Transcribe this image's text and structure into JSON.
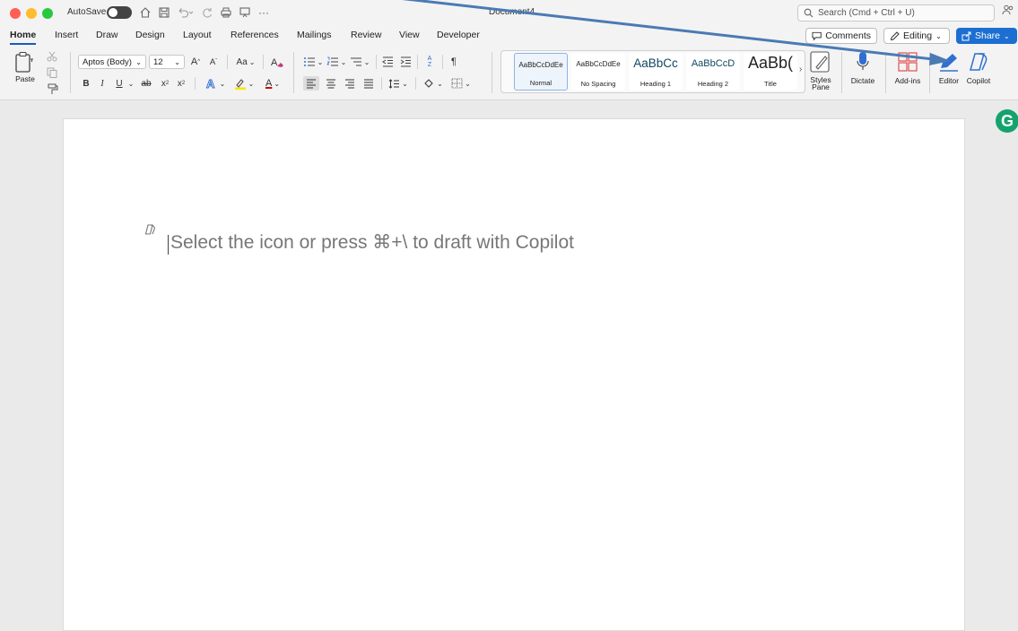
{
  "titlebar": {
    "autosave_label": "AutoSave",
    "document_title": "Document4",
    "search_placeholder": "Search (Cmd + Ctrl + U)"
  },
  "tabs": [
    "Home",
    "Insert",
    "Draw",
    "Design",
    "Layout",
    "References",
    "Mailings",
    "Review",
    "View",
    "Developer"
  ],
  "tab_buttons": {
    "comments": "Comments",
    "editing": "Editing",
    "share": "Share"
  },
  "ribbon": {
    "paste_label": "Paste",
    "font_name": "Aptos (Body)",
    "font_size": "12",
    "grow_font": "A",
    "shrink_font": "A",
    "change_case": "Aa",
    "bold": "B",
    "italic": "I",
    "underline": "U",
    "strikethrough": "ab",
    "subscript": "x",
    "superscript": "x",
    "font_color": "A",
    "pilcrow": "¶",
    "sort": "A Z"
  },
  "styles": [
    {
      "sample": "AaBbCcDdEe",
      "name": "Normal"
    },
    {
      "sample": "AaBbCcDdEe",
      "name": "No Spacing"
    },
    {
      "sample": "AaBbCc",
      "name": "Heading 1"
    },
    {
      "sample": "AaBbCcD",
      "name": "Heading 2"
    },
    {
      "sample": "AaBb(",
      "name": "Title"
    }
  ],
  "ribbon_buttons": {
    "styles_pane_1": "Styles",
    "styles_pane_2": "Pane",
    "dictate": "Dictate",
    "addins": "Add-ins",
    "editor": "Editor",
    "copilot": "Copilot"
  },
  "document": {
    "copilot_hint": "Select the icon or press ⌘+\\ to draft with Copilot"
  },
  "colors": {
    "accent": "#185abd",
    "share_button": "#1c6fd1",
    "grammarly": "#15a36d",
    "arrow": "#4a7ab5"
  },
  "icons": {
    "grammarly": "G"
  }
}
